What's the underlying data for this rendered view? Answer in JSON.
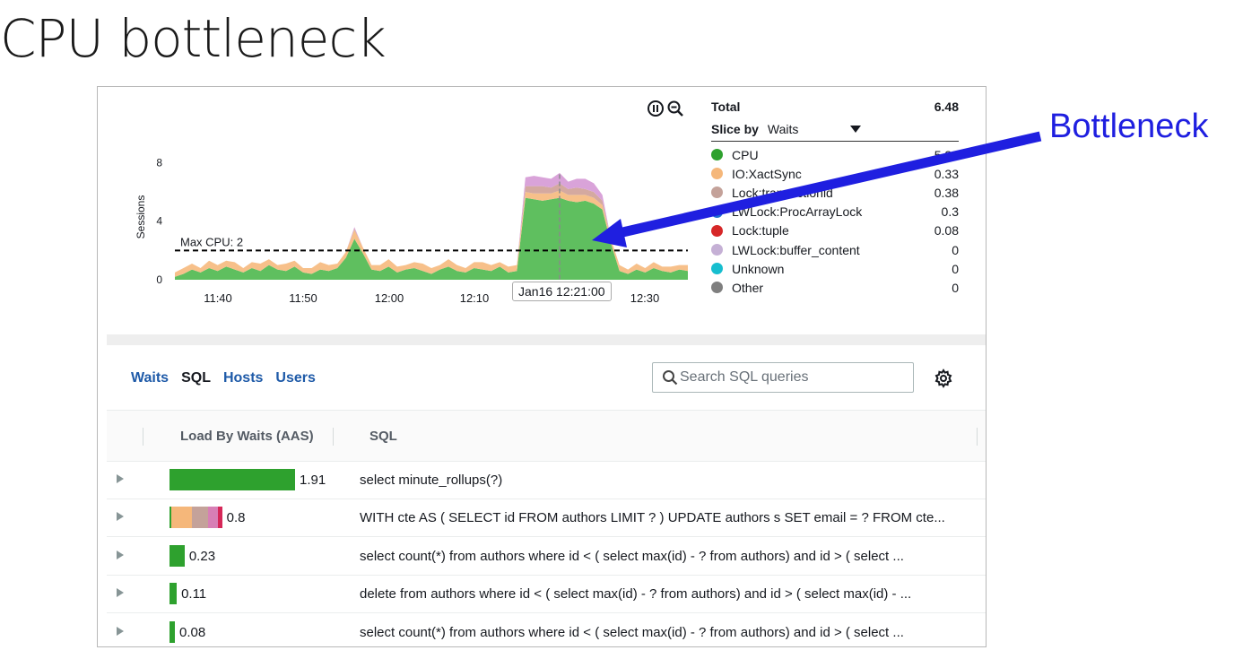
{
  "slide_title": "CPU bottleneck",
  "annotation": {
    "label": "Bottleneck",
    "color": "#1f1fe0"
  },
  "chart_controls": {
    "pause_icon": "pause-circle-icon",
    "zoom_out_icon": "zoom-out-icon"
  },
  "legend": {
    "total_label": "Total",
    "total_value": "6.48",
    "slice_by_label": "Slice by",
    "slice_by_value": "Waits",
    "dropdown_icon": "caret-down-icon",
    "items": [
      {
        "name": "CPU",
        "value": "5.38",
        "color": "#2ea12e"
      },
      {
        "name": "IO:XactSync",
        "value": "0.33",
        "color": "#f5b77a"
      },
      {
        "name": "Lock:transactionid",
        "value": "0.38",
        "color": "#c4a29a"
      },
      {
        "name": "LWLock:ProcArrayLock",
        "value": "0.3",
        "color": "#1f6fd1"
      },
      {
        "name": "Lock:tuple",
        "value": "0.08",
        "color": "#d62728"
      },
      {
        "name": "LWLock:buffer_content",
        "value": "0",
        "color": "#c5b0d5"
      },
      {
        "name": "Unknown",
        "value": "0",
        "color": "#17becf"
      },
      {
        "name": "Other",
        "value": "0",
        "color": "#7f7f7f"
      }
    ]
  },
  "chart_data": {
    "type": "area",
    "ylabel": "Sessions",
    "y_ticks": [
      "0",
      "4",
      "8"
    ],
    "ylim": [
      0,
      9.5
    ],
    "x_ticks": [
      "11:40",
      "11:50",
      "12:00",
      "12:10",
      "12:30"
    ],
    "threshold": {
      "label": "Max CPU: 2",
      "value": 2
    },
    "hover_time": "Jan16 12:21:00",
    "series": [
      {
        "name": "CPU",
        "color": "#5fbf5f",
        "values": [
          0.2,
          0.4,
          0.7,
          0.5,
          0.8,
          0.6,
          0.9,
          0.7,
          0.5,
          0.8,
          0.6,
          1.0,
          0.7,
          0.6,
          0.9,
          0.5,
          0.4,
          0.7,
          0.6,
          0.8,
          1.5,
          2.8,
          1.8,
          0.7,
          0.6,
          0.9,
          0.5,
          0.7,
          0.8,
          0.6,
          0.4,
          0.7,
          0.9,
          0.6,
          0.5,
          0.8,
          0.7,
          0.6,
          0.9,
          0.5,
          0.6,
          5.6,
          5.5,
          5.4,
          5.5,
          5.6,
          5.4,
          5.3,
          5.4,
          5.2,
          4.8,
          2.5,
          0.6,
          0.4,
          0.7,
          0.5,
          0.8,
          0.6,
          0.5,
          0.7,
          0.6
        ]
      },
      {
        "name": "IO:XactSync",
        "color": "#f7c08a",
        "values": [
          0.3,
          0.4,
          0.4,
          0.3,
          0.5,
          0.4,
          0.4,
          0.5,
          0.3,
          0.4,
          0.5,
          0.4,
          0.3,
          0.5,
          0.4,
          0.3,
          0.4,
          0.5,
          0.4,
          0.3,
          0.4,
          0.6,
          0.4,
          0.3,
          0.4,
          0.5,
          0.4,
          0.3,
          0.4,
          0.5,
          0.4,
          0.3,
          0.5,
          0.4,
          0.3,
          0.4,
          0.5,
          0.4,
          0.3,
          0.4,
          0.4,
          0.4,
          0.4,
          0.5,
          0.4,
          0.5,
          0.4,
          0.5,
          0.4,
          0.4,
          0.3,
          0.3,
          0.4,
          0.3,
          0.4,
          0.3,
          0.4,
          0.3,
          0.4,
          0.3,
          0.4
        ]
      },
      {
        "name": "Lock:transactionid",
        "color": "#d4a9a0",
        "values": [
          0,
          0,
          0,
          0,
          0,
          0,
          0,
          0,
          0,
          0,
          0,
          0,
          0,
          0,
          0,
          0,
          0,
          0,
          0,
          0,
          0,
          0.1,
          0,
          0,
          0,
          0,
          0,
          0,
          0,
          0,
          0,
          0,
          0,
          0,
          0,
          0,
          0,
          0,
          0,
          0,
          0,
          0.4,
          0.5,
          0.5,
          0.4,
          0.5,
          0.4,
          0.5,
          0.4,
          0.4,
          0.3,
          0,
          0,
          0,
          0,
          0,
          0,
          0,
          0,
          0,
          0
        ]
      },
      {
        "name": "LWLock:buffer_content",
        "color": "#d9a3d9",
        "values": [
          0,
          0,
          0,
          0,
          0,
          0,
          0,
          0,
          0,
          0,
          0,
          0,
          0,
          0,
          0,
          0,
          0,
          0,
          0,
          0,
          0,
          0.1,
          0,
          0,
          0,
          0,
          0,
          0,
          0,
          0,
          0,
          0,
          0,
          0,
          0,
          0,
          0,
          0,
          0,
          0,
          0,
          0.6,
          0.7,
          0.6,
          0.6,
          0.7,
          0.5,
          0.6,
          0.7,
          0.6,
          0.4,
          0,
          0,
          0,
          0,
          0,
          0,
          0,
          0,
          0,
          0
        ]
      }
    ]
  },
  "tabs": [
    "Waits",
    "SQL",
    "Hosts",
    "Users"
  ],
  "active_tab": "SQL",
  "search": {
    "placeholder": "Search SQL queries",
    "icon": "search-icon"
  },
  "settings_icon": "gear-icon",
  "table": {
    "headers": [
      "Load By Waits (AAS)",
      "SQL"
    ],
    "max_load": 1.91,
    "rows": [
      {
        "load": "1.91",
        "sql": "select minute_rollups(?)",
        "segments": [
          {
            "fraction": 1.0,
            "color": "#2ea12e"
          }
        ]
      },
      {
        "load": "0.8",
        "sql": "WITH cte AS ( SELECT id FROM authors LIMIT ? ) UPDATE authors s SET email = ? FROM cte...",
        "segments": [
          {
            "fraction": 0.02,
            "color": "#2ea12e"
          },
          {
            "fraction": 0.4,
            "color": "#f5b77a"
          },
          {
            "fraction": 0.3,
            "color": "#c4a29a"
          },
          {
            "fraction": 0.18,
            "color": "#d77fb5"
          },
          {
            "fraction": 0.1,
            "color": "#d62758"
          }
        ]
      },
      {
        "load": "0.23",
        "sql": "select count(*) from authors where id < ( select max(id) - ? from authors) and id > ( select ...",
        "segments": [
          {
            "fraction": 1.0,
            "color": "#2ea12e"
          }
        ]
      },
      {
        "load": "0.11",
        "sql": "delete from authors where id < ( select max(id) - ? from authors) and id > ( select max(id) - ...",
        "segments": [
          {
            "fraction": 1.0,
            "color": "#2ea12e"
          }
        ]
      },
      {
        "load": "0.08",
        "sql": "select count(*) from authors where id < ( select max(id) - ? from authors) and id > ( select ...",
        "segments": [
          {
            "fraction": 1.0,
            "color": "#2ea12e"
          }
        ]
      }
    ]
  }
}
